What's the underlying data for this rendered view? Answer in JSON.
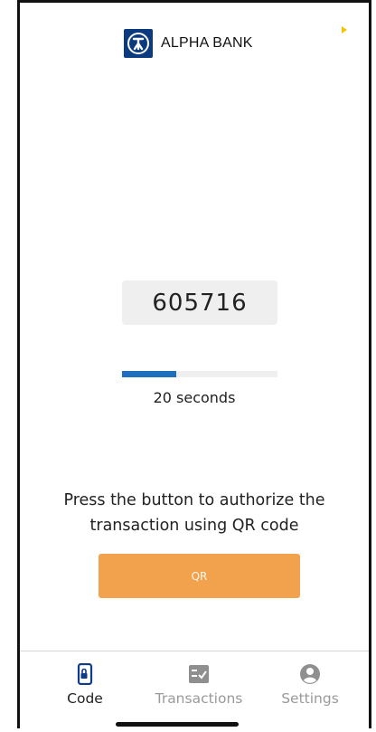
{
  "header": {
    "brand_name": "ALPHA BANK",
    "brand_color": "#0b3a7e",
    "logo_icon": "alpha-bank-logo-icon",
    "indicator_color": "#f5c400"
  },
  "otp": {
    "code": "605716",
    "remaining_label": "20 seconds",
    "remaining_fraction": 0.35,
    "progress_color": "#1f6fbf"
  },
  "qr_section": {
    "prompt": "Press the button to authorize the transaction using QR code",
    "button_label": "QR",
    "button_color": "#f2a24c"
  },
  "tabbar": {
    "tabs": [
      {
        "label": "Code",
        "icon": "phone-lock-icon",
        "active": true
      },
      {
        "label": "Transactions",
        "icon": "checklist-icon",
        "active": false
      },
      {
        "label": "Settings",
        "icon": "account-circle-icon",
        "active": false
      }
    ]
  }
}
